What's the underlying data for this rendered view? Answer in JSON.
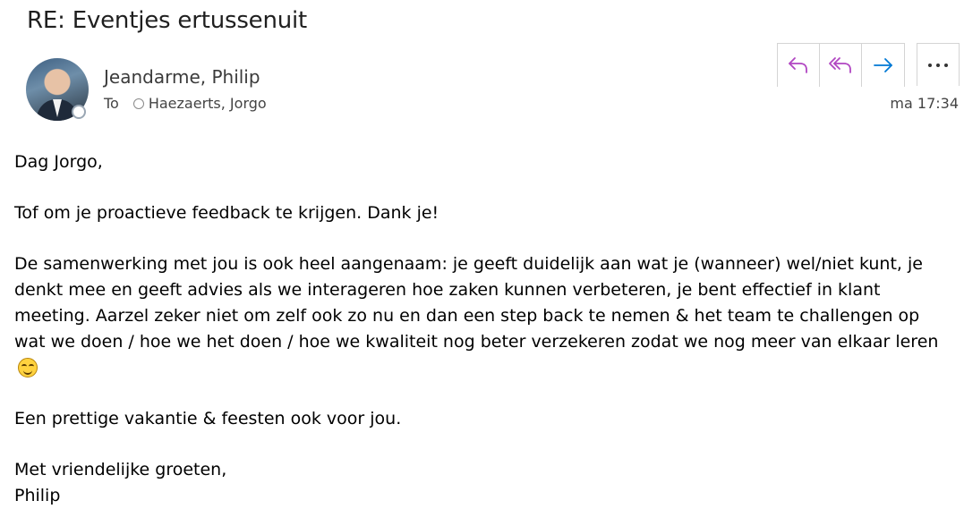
{
  "email": {
    "subject": "RE: Eventjes ertussenuit",
    "sender": "Jeandarme, Philip",
    "to_label": "To",
    "recipient": "Haezaerts, Jorgo",
    "timestamp": "ma 17:34"
  },
  "actions": {
    "reply_icon": "reply-icon",
    "reply_all_icon": "reply-all-icon",
    "forward_icon": "forward-icon",
    "more_icon": "more-icon"
  },
  "colors": {
    "reply_accent": "#b146c2",
    "forward_accent": "#0078d4"
  },
  "body": {
    "greeting": "Dag Jorgo,",
    "p1": "Tof om je proactieve feedback te krijgen. Dank je!",
    "p2": "De samenwerking met jou is ook heel aangenaam: je geeft duidelijk aan wat je (wanneer) wel/niet kunt, je denkt mee en geeft advies als we interageren hoe zaken kunnen verbeteren, je bent effectief in klant meeting. Aarzel zeker niet om zelf ook zo nu en dan een step back te nemen & het team te challengen op wat we doen / hoe we het doen / hoe we kwaliteit nog beter verzekeren zodat we nog meer van elkaar leren",
    "p3": "Een prettige vakantie & feesten ook voor jou.",
    "closing": "Met vriendelijke groeten,",
    "signature": "Philip"
  }
}
